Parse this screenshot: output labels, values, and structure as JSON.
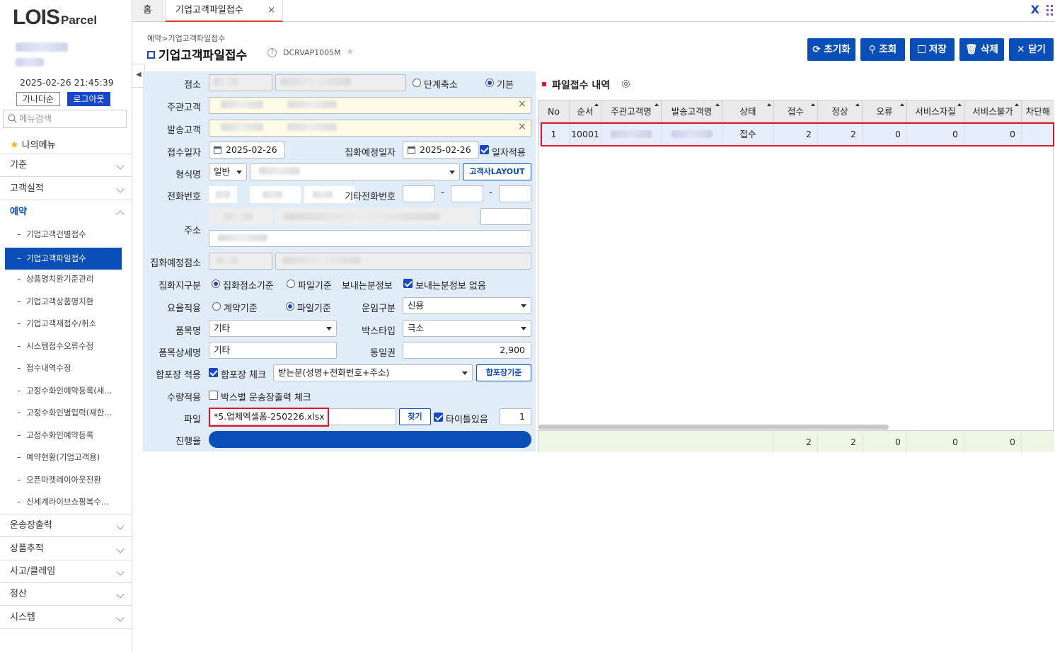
{
  "brand": {
    "logo_main": "LOIS",
    "logo_sub": "Parcel"
  },
  "session": {
    "datetime": "2025-02-26 21:45:39",
    "sort_button": "가나다순",
    "logout_button": "로그아웃"
  },
  "sidebar": {
    "search_placeholder": "메뉴검색",
    "my_menu": "나의메뉴",
    "top_groups": [
      "기준",
      "고객실적"
    ],
    "open_group": "예약",
    "sub_items": [
      "기업고객건별접수",
      "기업고객파일접수",
      "상품명치환기준관리",
      "기업고객상품명치환",
      "기업고객재접수/취소",
      "시스템접수오류수정",
      "접수내역수정",
      "고정수화인예약등록(새...",
      "고정수화인별입력(재한...",
      "고정수화인예약등록",
      "예약현황(기업고객용)",
      "오픈마켓레이아웃전환",
      "신세계라이브쇼핑복수..."
    ],
    "bottom_groups": [
      "운송장출력",
      "상품추적",
      "사고/클레임",
      "정산",
      "시스템"
    ]
  },
  "tabs": {
    "home": "홈",
    "active": "기업고객파일접수",
    "close": "×",
    "right_x": "X"
  },
  "header": {
    "breadcrumb": "예약>기업고객파일접수",
    "title": "기업고객파일접수",
    "code": "DCRVAP1005M"
  },
  "toolbar": {
    "reset": "초기화",
    "search": "조회",
    "save": "저장",
    "delete": "삭제",
    "close": "닫기"
  },
  "form": {
    "labels": {
      "branch": "점소",
      "main_customer": "주관고객",
      "send_customer": "발송고객",
      "receipt_date": "접수일자",
      "pickup_date": "집화예정일자",
      "format": "형식명",
      "phone": "전화번호",
      "other_phone": "기타전화번호",
      "address": "주소",
      "pickup_branch": "집화예정점소",
      "pickup_type": "집화지구분",
      "sender_info": "보내는분정보",
      "rate": "요율적용",
      "fare_type": "운임구분",
      "item_name": "품목명",
      "box_type": "박스타입",
      "item_detail": "품목상세명",
      "same_zone": "동일권",
      "merge": "합포장 적용",
      "quantity": "수량적용",
      "file": "파일",
      "progress": "진행율"
    },
    "branch_radio_1": "단계축소",
    "branch_radio_2": "기본",
    "receipt_date": "2025-02-26",
    "pickup_date": "2025-02-26",
    "date_apply": "일자적용",
    "format_type": "일반",
    "layout_button": "고객사LAYOUT",
    "pickup_radio_1": "집화점소기준",
    "pickup_radio_2": "파일기준",
    "no_sender_info": "보내는분정보 없음",
    "rate_radio_1": "계약기준",
    "rate_radio_2": "파일기준",
    "fare_type": "신용",
    "item_name": "기타",
    "box_type": "극소",
    "item_detail": "기타",
    "same_zone": "2,900",
    "merge_check": "합포장 체크",
    "merge_option": "받는분(성명+전화번호+주소)",
    "merge_button": "합포장기준",
    "box_print_check": "박스별 운송장출력 체크",
    "file_name": "*5.업체엑셀폼-250226.xlsx",
    "find_button": "찾기",
    "title_check": "타이틀있음",
    "title_row": "1",
    "dash": "-"
  },
  "grid": {
    "title": "파일접수 내역",
    "columns": [
      "No",
      "순서",
      "주관고객명",
      "발송고객명",
      "상태",
      "접수",
      "정상",
      "오류",
      "서비스자질",
      "서비스불가",
      "차단해"
    ],
    "rows": [
      {
        "no": "1",
        "seq": "10001",
        "status": "접수",
        "received": "2",
        "normal": "2",
        "error": "0",
        "svc_err": "0",
        "svc_unavail": "0"
      }
    ],
    "footer": {
      "received": "2",
      "normal": "2",
      "error": "0",
      "svc_err": "0",
      "svc_unavail": "0"
    }
  },
  "colors": {
    "accent": "#0a4eb8",
    "highlight": "#e0142a",
    "form_bg": "#e1ecf9"
  }
}
